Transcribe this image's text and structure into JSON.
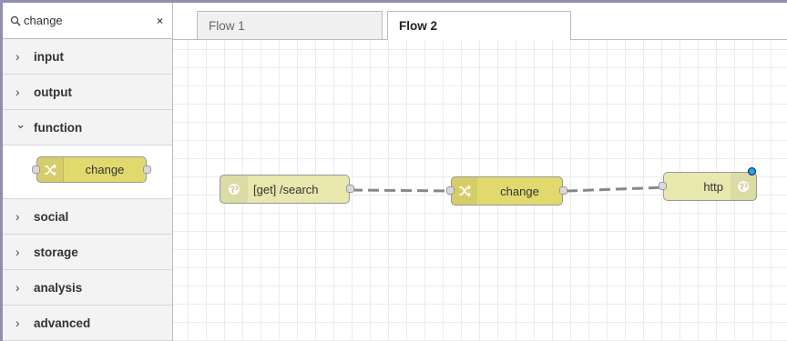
{
  "search": {
    "value": "change",
    "clear_glyph": "×",
    "icon": "search-icon"
  },
  "palette": {
    "categories_top": [
      {
        "label": "input"
      },
      {
        "label": "output"
      }
    ],
    "expanded": {
      "label": "function",
      "chevron": "⌄",
      "node_label": "change",
      "node_icon": "shuffle-icon"
    },
    "categories_bottom": [
      {
        "label": "social"
      },
      {
        "label": "storage"
      },
      {
        "label": "analysis"
      },
      {
        "label": "advanced"
      }
    ],
    "chevron": "›"
  },
  "tabs": [
    {
      "label": "Flow 1"
    },
    {
      "label": "Flow 2"
    }
  ],
  "flow": {
    "nodes": {
      "http_in": {
        "label": "[get] /search",
        "icon": "globe-icon"
      },
      "change": {
        "label": "change",
        "icon": "shuffle-icon"
      },
      "http_response": {
        "label": "http",
        "icon": "globe-icon"
      }
    }
  },
  "colors": {
    "change_node": "#e2d96e",
    "http_node": "#e7e7ae",
    "frame": "#8f8fb3",
    "changed_indicator": "#21a5e3"
  }
}
